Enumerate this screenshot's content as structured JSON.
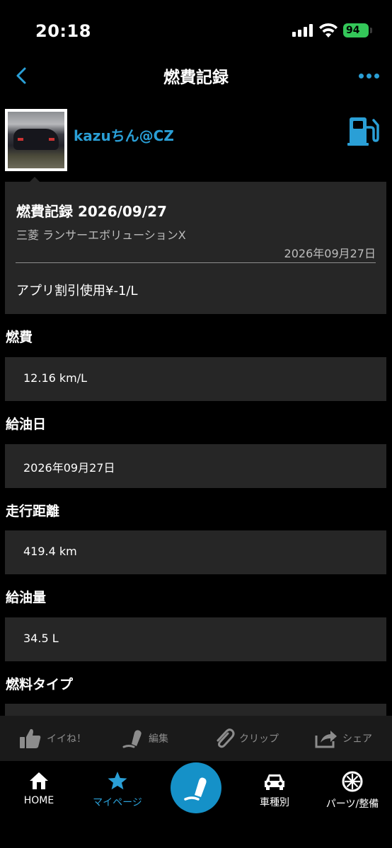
{
  "status_bar": {
    "time": "20:18",
    "battery": "94"
  },
  "navbar": {
    "title": "燃費記録"
  },
  "profile": {
    "username": "kazuちん@CZ"
  },
  "record": {
    "title": "燃費記録 2026/09/27",
    "car": "三菱 ランサーエボリューションX",
    "date": "2026年09月27日",
    "note": "アプリ割引使用¥-1/L"
  },
  "fields": [
    {
      "label": "燃費",
      "value": "12.16 km/L"
    },
    {
      "label": "給油日",
      "value": "2026年09月27日"
    },
    {
      "label": "走行距離",
      "value": "419.4 km"
    },
    {
      "label": "給油量",
      "value": "34.5 L"
    },
    {
      "label": "燃料タイプ",
      "value": ""
    }
  ],
  "actions": {
    "like": "イイね！",
    "edit": "編集",
    "clip": "クリップ",
    "share": "シェア"
  },
  "tabs": {
    "home": "HOME",
    "mypage": "マイページ",
    "by_car": "車種別",
    "parts": "パーツ/整備"
  },
  "colors": {
    "accent": "#2a9fd6",
    "card": "#262626",
    "battery": "#34c759"
  }
}
